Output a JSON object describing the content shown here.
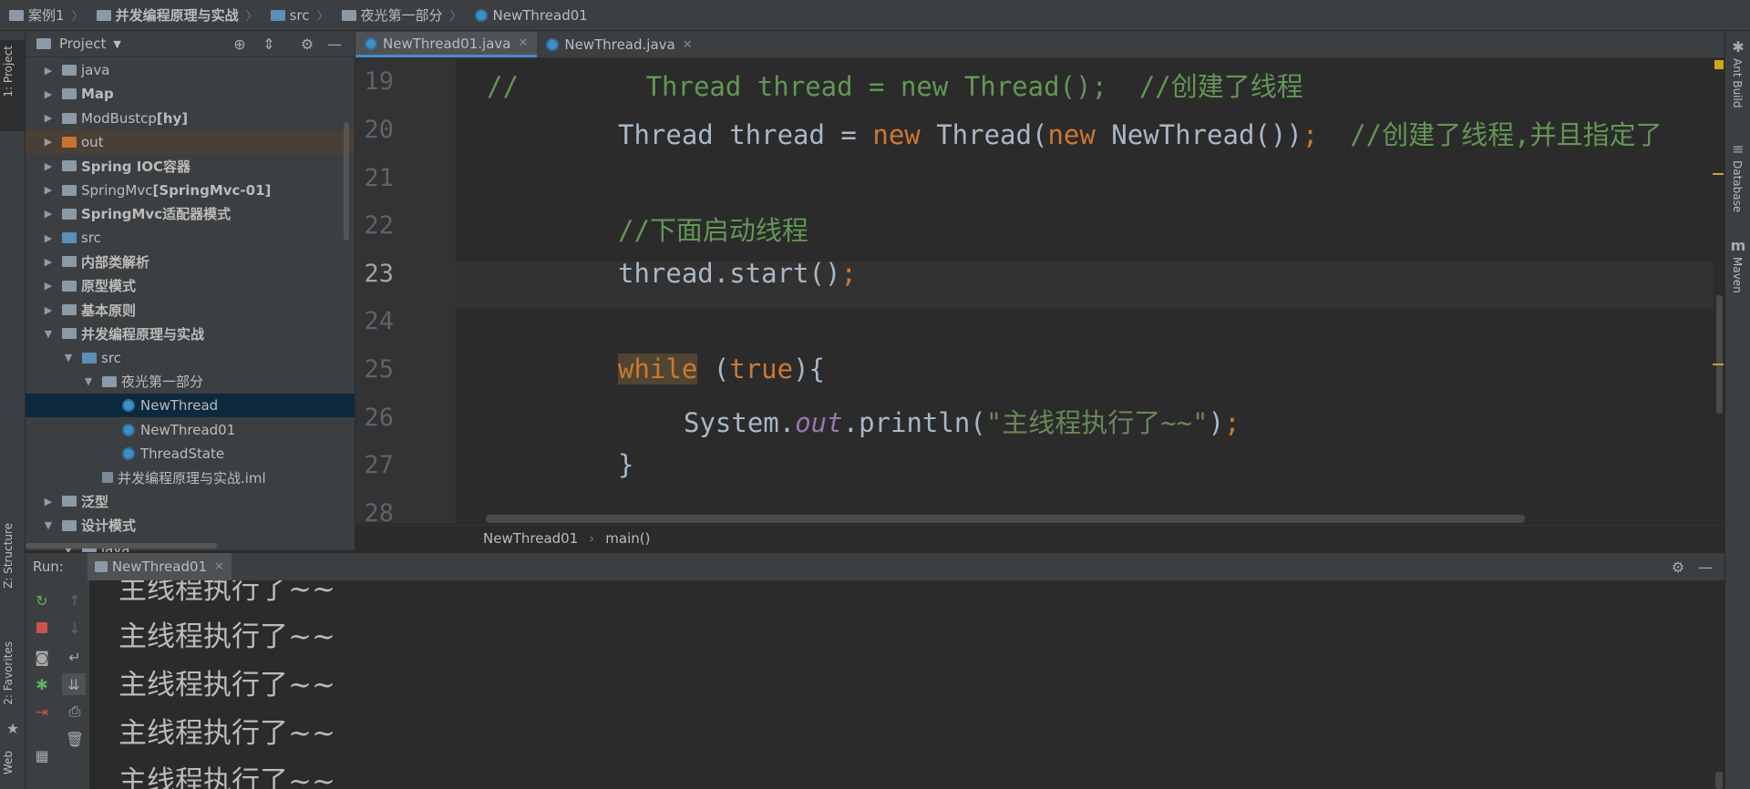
{
  "breadcrumb": [
    "案例1",
    "并发编程原理与实战",
    "src",
    "夜光第一部分",
    "NewThread01"
  ],
  "left_tabs": {
    "project": "1: Project",
    "structure": "Z: Structure",
    "favorites": "2: Favorites",
    "web": "Web"
  },
  "project_panel": {
    "title": "Project"
  },
  "tree": [
    {
      "label": "java",
      "bold": "",
      "depth": 0,
      "arrow": "▶",
      "icon": "folder"
    },
    {
      "label": "Map",
      "bold": "",
      "depth": 0,
      "arrow": "▶",
      "icon": "folder",
      "strong": true
    },
    {
      "label": "ModBustcp ",
      "bold": "[hy]",
      "depth": 0,
      "arrow": "▶",
      "icon": "folder"
    },
    {
      "label": "out",
      "bold": "",
      "depth": 0,
      "arrow": "▶",
      "icon": "folder-orange"
    },
    {
      "label": "Spring IOC容器",
      "bold": "",
      "depth": 0,
      "arrow": "▶",
      "icon": "folder",
      "strong": true
    },
    {
      "label": "SpringMvc ",
      "bold": "[SpringMvc-01]",
      "depth": 0,
      "arrow": "▶",
      "icon": "folder"
    },
    {
      "label": "SpringMvc适配器模式",
      "bold": "",
      "depth": 0,
      "arrow": "▶",
      "icon": "folder",
      "strong": true
    },
    {
      "label": "src",
      "bold": "",
      "depth": 0,
      "arrow": "▶",
      "icon": "folder-blue"
    },
    {
      "label": "内部类解析",
      "bold": "",
      "depth": 0,
      "arrow": "▶",
      "icon": "folder",
      "strong": true
    },
    {
      "label": "原型模式",
      "bold": "",
      "depth": 0,
      "arrow": "▶",
      "icon": "folder",
      "strong": true
    },
    {
      "label": "基本原则",
      "bold": "",
      "depth": 0,
      "arrow": "▶",
      "icon": "folder",
      "strong": true
    },
    {
      "label": "并发编程原理与实战",
      "bold": "",
      "depth": 0,
      "arrow": "▼",
      "icon": "folder",
      "strong": true
    },
    {
      "label": "src",
      "bold": "",
      "depth": 1,
      "arrow": "▼",
      "icon": "folder-blue"
    },
    {
      "label": "夜光第一部分",
      "bold": "",
      "depth": 2,
      "arrow": "▼",
      "icon": "package"
    },
    {
      "label": "NewThread",
      "bold": "",
      "depth": 3,
      "arrow": "",
      "icon": "class"
    },
    {
      "label": "NewThread01",
      "bold": "",
      "depth": 3,
      "arrow": "",
      "icon": "class"
    },
    {
      "label": "ThreadState",
      "bold": "",
      "depth": 3,
      "arrow": "",
      "icon": "class"
    },
    {
      "label": "并发编程原理与实战.iml",
      "bold": "",
      "depth": 2,
      "arrow": "",
      "icon": "file"
    },
    {
      "label": "泛型",
      "bold": "",
      "depth": 0,
      "arrow": "▶",
      "icon": "folder",
      "strong": true
    },
    {
      "label": "设计模式",
      "bold": "",
      "depth": 0,
      "arrow": "▼",
      "icon": "folder",
      "strong": true
    },
    {
      "label": "java",
      "bold": "",
      "depth": 1,
      "arrow": "▼",
      "icon": "folder"
    }
  ],
  "tabs": [
    {
      "label": "NewThread01.java",
      "active": true
    },
    {
      "label": "NewThread.java",
      "active": false
    }
  ],
  "line_numbers": [
    "19",
    "20",
    "21",
    "22",
    "23",
    "24",
    "25",
    "26",
    "27",
    "28"
  ],
  "code": {
    "l19": "//        Thread thread = new Thread();  //创建了线程",
    "l20_a": "Thread thread = ",
    "l20_new1": "new",
    "l20_b": " Thread(",
    "l20_new2": "new",
    "l20_c": " NewThread())",
    "l20_semi": ";",
    "l20_cm": "  //创建了线程,并且指定了",
    "l22": "//下面启动线程",
    "l23_a": "thread.start()",
    "l23_semi": ";",
    "l25_kw": "while",
    "l25_a": " (",
    "l25_true": "true",
    "l25_b": "){",
    "l26_a": "System.",
    "l26_out": "out",
    "l26_b": ".println(",
    "l26_str": "\"主线程执行了~~\"",
    "l26_c": ")",
    "l26_semi": ";",
    "l27": "}"
  },
  "editor_crumbs": [
    "NewThread01",
    "main()"
  ],
  "run": {
    "label": "Run:",
    "tab": "NewThread01"
  },
  "console_lines": [
    "主线程执行了~~",
    "主线程执行了~~",
    "主线程执行了~~",
    "主线程执行了~~",
    "主线程执行了~~"
  ],
  "right_tabs": {
    "ant": "Ant Build",
    "database": "Database",
    "maven": "Maven"
  },
  "colors": {
    "keyword": "#cc7832",
    "comment": "#629755",
    "string": "#6a8759",
    "selection": "#0d293e",
    "accent": "#4a88c7"
  }
}
